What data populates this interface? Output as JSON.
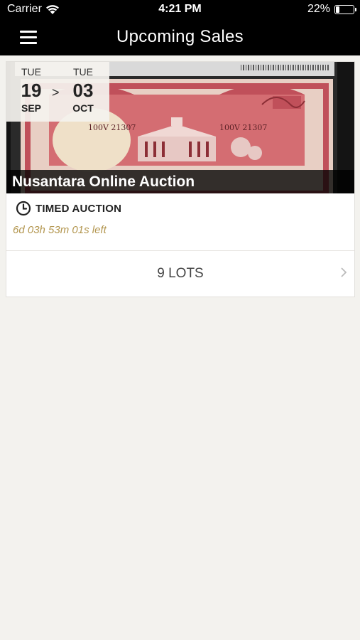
{
  "status_bar": {
    "carrier": "Carrier",
    "time": "4:21 PM",
    "battery": "22%",
    "battery_level": 0.22
  },
  "nav": {
    "title": "Upcoming Sales",
    "menu_icon": "hamburger-menu-icon"
  },
  "sale": {
    "start": {
      "dow": "TUE",
      "day": "19",
      "month": "SEP"
    },
    "separator": ">",
    "end": {
      "dow": "TUE",
      "day": "03",
      "month": "OCT"
    },
    "title": "Nusantara Online Auction",
    "type_icon": "clock-icon",
    "type": "TIMED AUCTION",
    "countdown": "6d 03h 53m 01s left",
    "lots": "9 LOTS",
    "banner_image": "banknote-photo",
    "banknote_serial": "100V 21307",
    "colors": {
      "countdown": "#b3964f",
      "banknote": "#c0505a"
    }
  }
}
